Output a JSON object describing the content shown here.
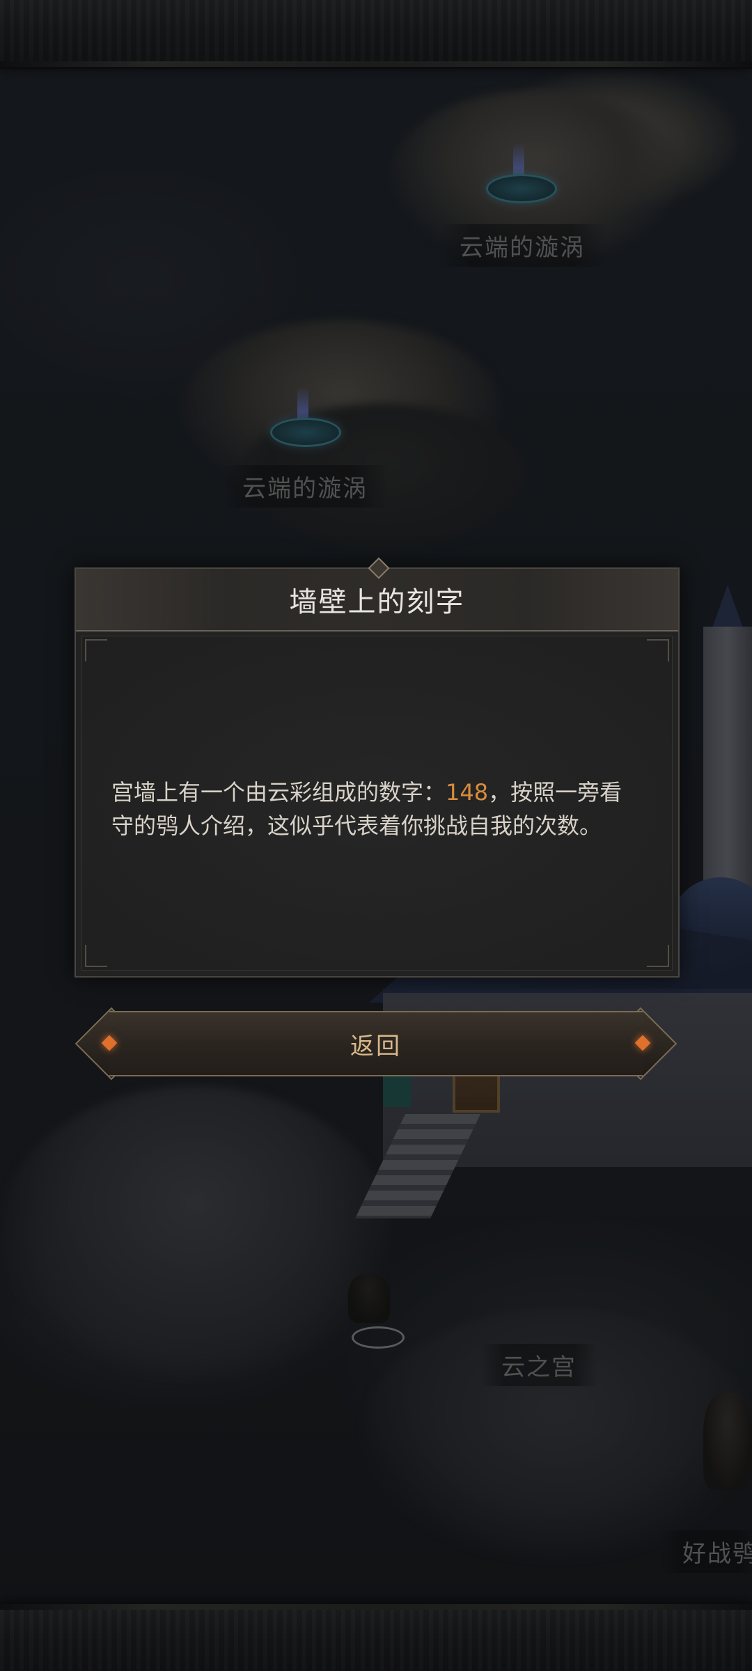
{
  "map": {
    "locations": [
      {
        "label": "云端的漩涡"
      },
      {
        "label": "云端的漩涡"
      },
      {
        "label": "云之宫"
      },
      {
        "label": "好战鸮"
      }
    ]
  },
  "dialog": {
    "title": "墙壁上的刻字",
    "text_before": "宫墙上有一个由云彩组成的数字：",
    "number": "148",
    "text_after": "，按照一旁看守的鸮人介绍，这似乎代表着你挑战自我的次数。",
    "number_color": "#d88c3c"
  },
  "buttons": {
    "return_label": "返回"
  }
}
